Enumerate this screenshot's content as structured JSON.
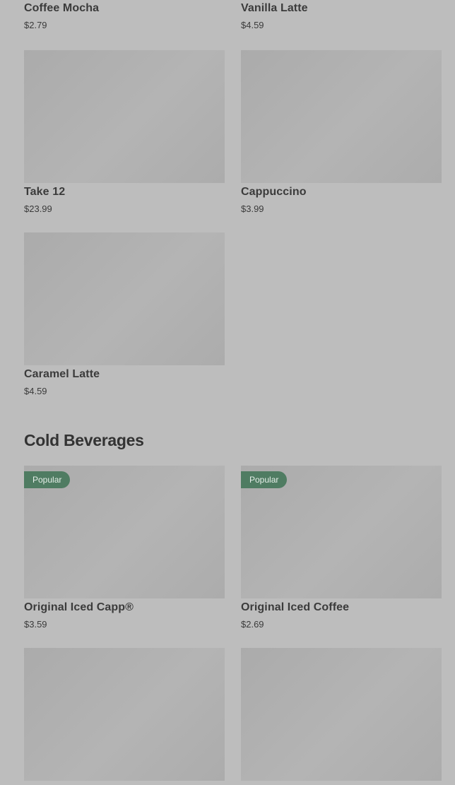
{
  "hot_items": [
    {
      "name": "Coffee Mocha",
      "price": "$2.79"
    },
    {
      "name": "Vanilla Latte",
      "price": "$4.59"
    },
    {
      "name": "Take 12",
      "price": "$23.99"
    },
    {
      "name": "Cappuccino",
      "price": "$3.99"
    },
    {
      "name": "Caramel Latte",
      "price": "$4.59"
    }
  ],
  "cold_section": {
    "title": "Cold Beverages",
    "items": [
      {
        "name": "Original Iced Capp®",
        "price": "$3.59",
        "badge": "Popular"
      },
      {
        "name": "Original Iced Coffee",
        "price": "$2.69",
        "badge": "Popular"
      }
    ]
  },
  "colors": {
    "overlay_background": "#bdbdbd",
    "image_placeholder": "#b0b0b0",
    "badge_green": "#4f7c62",
    "text_dark": "#3b3b3b"
  }
}
